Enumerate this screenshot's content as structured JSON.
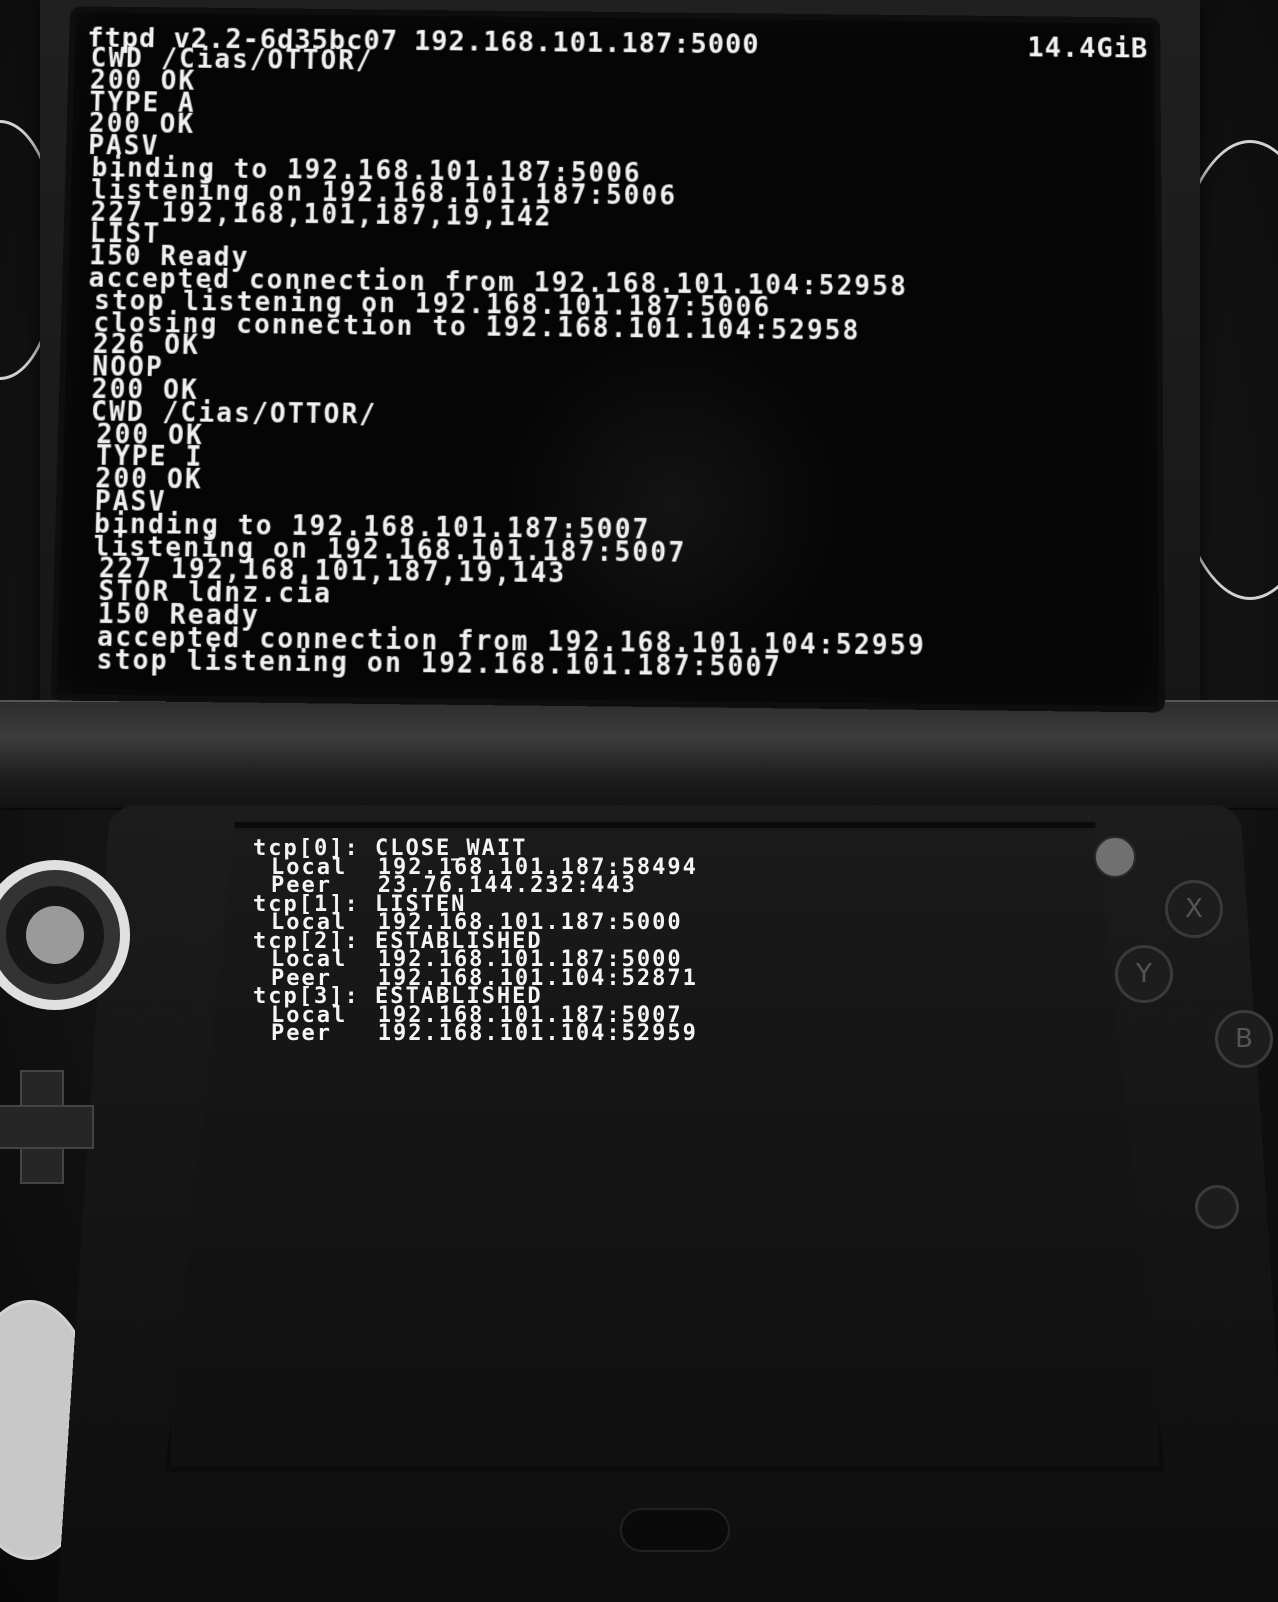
{
  "top_screen": {
    "app_title": "ftpd v2.2-6d35bc07",
    "server_address": "192.168.101.187:5000",
    "free_space": "14.4GiB",
    "log": [
      "CWD /Cias/OTTOR/",
      "200 OK",
      "TYPE A",
      "200 OK",
      "PASV",
      "binding to 192.168.101.187:5006",
      "listening on 192.168.101.187:5006",
      "227 192,168,101,187,19,142",
      "LIST",
      "150 Ready",
      "accepted connection from 192.168.101.104:52958",
      "stop listening on 192.168.101.187:5006",
      "closing connection to 192.168.101.104:52958",
      "226 OK",
      "NOOP",
      "200 OK",
      "CWD /Cias/OTTOR/",
      "200 OK",
      "TYPE I",
      "200 OK",
      "PASV",
      "binding to 192.168.101.187:5007",
      "listening on 192.168.101.187:5007",
      "227 192,168,101,187,19,143",
      "STOR ldnz.cia",
      "150 Ready",
      "accepted connection from 192.168.101.104:52959",
      "stop listening on 192.168.101.187:5007"
    ]
  },
  "bottom_screen": {
    "sockets": [
      {
        "header": "tcp[0]: CLOSE_WAIT",
        "local": "Local  192.168.101.187:58494",
        "peer": "Peer   23.76.144.232:443"
      },
      {
        "header": "tcp[1]: LISTEN",
        "local": "Local  192.168.101.187:5000",
        "peer": ""
      },
      {
        "header": "tcp[2]: ESTABLISHED",
        "local": "Local  192.168.101.187:5000",
        "peer": "Peer   192.168.101.104:52871"
      },
      {
        "header": "tcp[3]: ESTABLISHED",
        "local": "Local  192.168.101.187:5007",
        "peer": "Peer   192.168.101.104:52959"
      }
    ]
  },
  "hardware": {
    "button_x": "X",
    "button_y": "Y",
    "button_b": "B"
  },
  "colors": {
    "screen_text": "#f0f0f0",
    "screen_bg": "#050505",
    "shell": "#161616"
  }
}
